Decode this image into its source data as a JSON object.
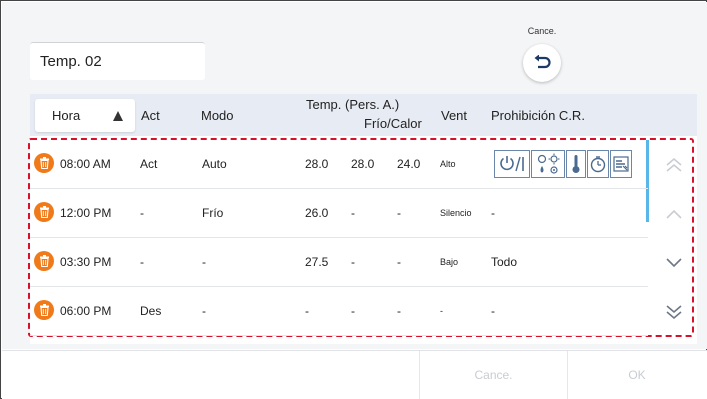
{
  "schedule_name": "Temp. 02",
  "cancel_top": {
    "label": "Cance."
  },
  "table": {
    "headers": {
      "sort_label": "Hora",
      "act": "Act",
      "modo": "Modo",
      "temp": "Temp. (Pers. A.)",
      "frio_calor": "Frío/Calor",
      "vent": "Vent",
      "prohibicion": "Prohibición C.R."
    },
    "rows": [
      {
        "time": "08:00 AM",
        "act": "Act",
        "modo": "Auto",
        "t1": "28.0",
        "t2": "28.0",
        "t3": "24.0",
        "vent": "Alto",
        "prohib": ""
      },
      {
        "time": "12:00 PM",
        "act": "-",
        "modo": "Frío",
        "t1": "26.0",
        "t2": "-",
        "t3": "-",
        "vent": "Silencio",
        "prohib": "-"
      },
      {
        "time": "03:30 PM",
        "act": "-",
        "modo": "-",
        "t1": "27.5",
        "t2": "-",
        "t3": "-",
        "vent": "Bajo",
        "prohib": "Todo"
      },
      {
        "time": "06:00 PM",
        "act": "Des",
        "modo": "-",
        "t1": "-",
        "t2": "-",
        "t3": "-",
        "vent": "-",
        "prohib": "-"
      }
    ]
  },
  "icons": {
    "delete": "trash-icon",
    "undo": "undo-arrow-icon",
    "sort": "sort-ascending-icon",
    "prohibitions": [
      "power-icon",
      "mode-icon",
      "temperature-icon",
      "timer-icon",
      "vent-icon"
    ],
    "nav": [
      "page-up-icon",
      "scroll-up-icon",
      "scroll-down-icon",
      "page-down-icon"
    ]
  },
  "footer": {
    "cancel_label": "Cance.",
    "ok_label": "OK"
  },
  "colors": {
    "accent": "#f07a1a",
    "highlight_border": "#d8102a",
    "scroll_indicator": "#59b6e8",
    "header_bg": "#e7ebf3"
  }
}
